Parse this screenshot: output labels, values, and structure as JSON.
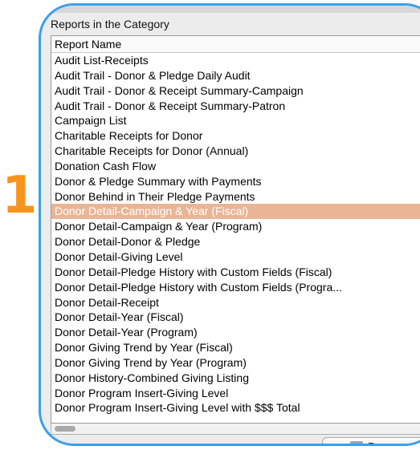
{
  "step": {
    "number": "1"
  },
  "panel": {
    "title": "Reports in the Category",
    "column_header": "Report Name"
  },
  "reports": [
    "Audit List-Receipts",
    "Audit Trail - Donor & Pledge Daily Audit",
    "Audit Trail - Donor & Receipt Summary-Campaign",
    "Audit Trail - Donor & Receipt Summary-Patron",
    "Campaign List",
    "Charitable Receipts for Donor",
    "Charitable Receipts for Donor (Annual)",
    "Donation Cash Flow",
    "Donor & Pledge Summary with Payments",
    "Donor Behind in Their Pledge Payments",
    "Donor Detail-Campaign & Year (Fiscal)",
    "Donor Detail-Campaign & Year (Program)",
    "Donor Detail-Donor & Pledge",
    "Donor Detail-Giving Level",
    "Donor Detail-Pledge History with Custom Fields (Fiscal)",
    "Donor Detail-Pledge History with Custom Fields (Progra...",
    "Donor Detail-Receipt",
    "Donor Detail-Year (Fiscal)",
    "Donor Detail-Year (Program)",
    "Donor Giving Trend by Year (Fiscal)",
    "Donor Giving Trend by Year (Program)",
    "Donor History-Combined Giving Listing",
    "Donor Program Insert-Giving Level",
    "Donor Program Insert-Giving Level with $$$ Total"
  ],
  "selected_report": "Donor Detail-Campaign & Year (Fiscal)",
  "button": {
    "label": "R"
  },
  "colors": {
    "accent_step": "#f7941d",
    "callout_border": "#3aa0e8",
    "selection": "#e8b597"
  }
}
